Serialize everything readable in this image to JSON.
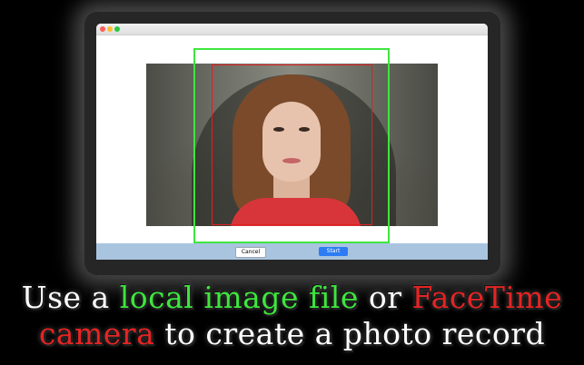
{
  "window": {
    "buttons": {
      "cancel": "Cancel",
      "start": "Start"
    }
  },
  "caption": {
    "line1": {
      "part1": "Use a ",
      "part2": "local image file",
      "part3": " or ",
      "part4": "FaceTime"
    },
    "line2": {
      "part1": "camera",
      "part2": " to create a photo record"
    }
  },
  "colors": {
    "background": "#000000",
    "green_highlight": "#3ee63e",
    "red_highlight": "#e52424",
    "start_button": "#2d7cf4",
    "bottom_bar": "#a9c4df"
  }
}
